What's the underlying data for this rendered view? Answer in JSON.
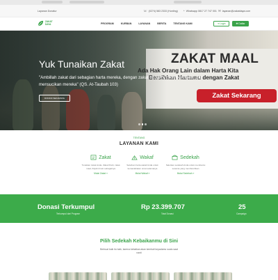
{
  "topbar": {
    "left_text": "Layanan Donatur",
    "phone": "(0274) 583 2333 (Hunting)",
    "whatsapp": "Whatsapp 0817 27 747 001",
    "email": "layanan@zakatdaya.com"
  },
  "nav": {
    "logo_line1": "ZAKAT",
    "logo_line2": "DAYA",
    "menu": [
      "PROGRAM",
      "KURBAN",
      "LAYANAN",
      "BERITA",
      "TENTANG KAMI"
    ],
    "login_label": "Login",
    "register_label": "Daftar"
  },
  "hero": {
    "title": "Yuk Tunaikan Zakat",
    "quote": "\"Ambillah zakat dari sebagian harta mereka, dengan zakat itu kamu membersihkan dan mensucikan mereka\" (QS. At-Taubah 103)",
    "button_label": "DONASI SEKARANG",
    "banner_title": "ZAKAT MAAL",
    "banner_line1": "Ada Hak Orang Lain dalam Harta Kita",
    "banner_line2": "Bersihkan Hartamu dengan Zakat",
    "banner_cta": "Zakat Sekarang",
    "slides": 3,
    "active_slide": 2
  },
  "services": {
    "tag": "TENTANG",
    "title": "LAYANAN KAMI",
    "items": [
      {
        "name": "Zakat",
        "icon": "zakat-icon",
        "desc": "Tunaikan zakat Anda. Zakat fitrah, zakat maal, fidyah & lain sebagainya",
        "link": "Mulai Zakat »"
      },
      {
        "name": "Wakaf",
        "icon": "wakaf-icon",
        "desc": "Salurkan harta wakaf Anda untuk kemaslahatan umat selamanya",
        "link": "Mulai Wakaf »"
      },
      {
        "name": "Sedekah",
        "icon": "sedekah-icon",
        "desc": "Salurkan sedekah Anda untuk membantu sesama yang membutuhkan",
        "link": "Mulai Sedekah »"
      }
    ]
  },
  "donation": {
    "title1": "Donasi Terkumpul",
    "sub1": "Terkumpul dari Program",
    "amount": "Rp 23.399.707",
    "sub2": "Total Donasi",
    "count": "25",
    "sub3": "Campaign"
  },
  "sedekah": {
    "title": "Pilih Sedekah Kebaikanmu di Sini",
    "desc": "Berbuat baik itu baik, karena kebaikan akan kembali kepadamu suatu saat nanti"
  },
  "colors": {
    "brand_green": "#3aa34a",
    "banner_red": "#c8202a"
  }
}
